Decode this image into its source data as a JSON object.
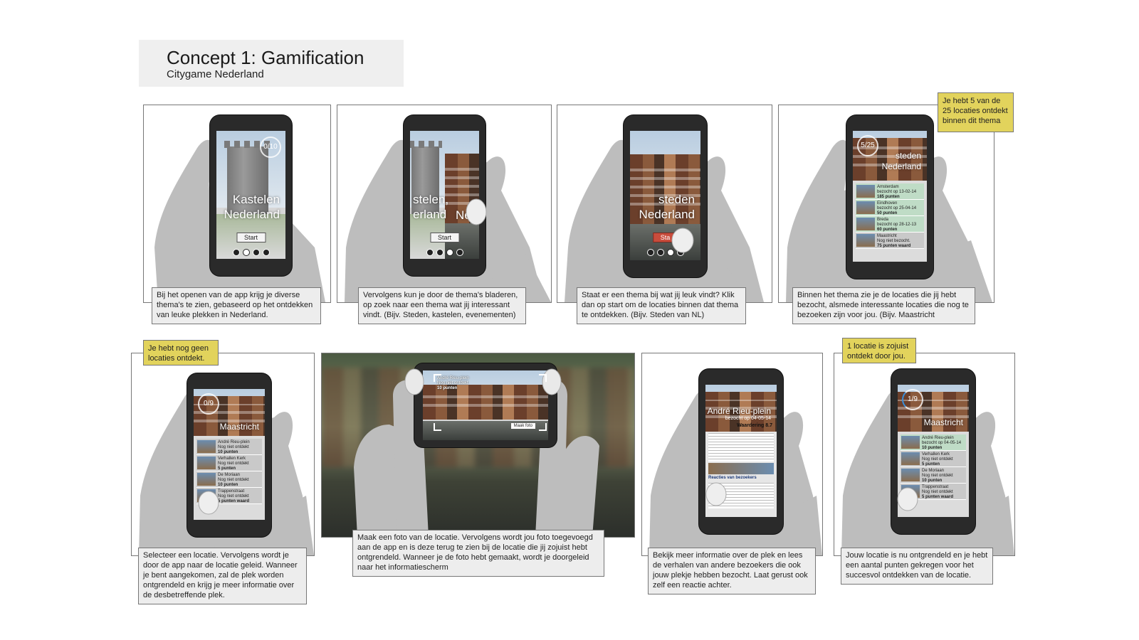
{
  "header": {
    "title": "Concept 1: Gamification",
    "subtitle": "Citygame Nederland"
  },
  "panels": [
    {
      "caption": "Bij het openen van de app krijg je diverse thema's te zien, gebaseerd op het ontdekken van leuke plekken in Nederland.",
      "screen_title": "Kastelen Nederland",
      "button": "Start",
      "counter": "0/10"
    },
    {
      "caption": "Vervolgens kun je door de thema's bladeren, op zoek naar een thema wat jij interessant vindt. (Bijv. Steden, kastelen, evenementen)",
      "screen_title": "stelen, erland",
      "screen_title_2": "Ne",
      "button": "Start"
    },
    {
      "caption": "Staat er een thema bij wat jij leuk vindt? Klik dan op start om de locaties binnen dat thema te ontdekken. (Bijv. Steden van NL)",
      "screen_title": "steden Nederland",
      "button": "Sta"
    },
    {
      "caption": "Binnen het thema zie je de locaties die jij hebt bezocht, alsmede interessante locaties die nog te bezoeken zijn voor jou. (Bijv. Maastricht",
      "note": "Je hebt 5 van de 25 locaties ontdekt binnen dit thema",
      "counter": "5/25",
      "screen_title": "steden Nederland",
      "list": [
        {
          "name": "Amsterdam",
          "sub": "bezocht op 13-02-14",
          "pts": "185 punten"
        },
        {
          "name": "Eindhoven",
          "sub": "bezocht op 25-04-14",
          "pts": "50 punten"
        },
        {
          "name": "Breda",
          "sub": "bezocht op 28-12-13",
          "pts": "60 punten"
        },
        {
          "name": "Maastricht",
          "sub": "Nog niet bezocht.",
          "pts": "75 punten waard"
        }
      ]
    },
    {
      "caption": "Selecteer een locatie. Vervolgens wordt je door de app naar de locatie geleid. Wanneer je bent aangekomen, zal de plek worden ontgrendeld en krijg je meer informatie over de desbetreffende plek.",
      "note": "Je hebt nog geen locaties ontdekt.",
      "counter": "0/9",
      "screen_title": "Maastricht",
      "list": [
        {
          "name": "André Rieu-plein",
          "sub": "Nog niet ontdekt",
          "pts": "10 punten"
        },
        {
          "name": "Verhallen Kerk",
          "sub": "Nog niet ontdekt",
          "pts": "5 punten"
        },
        {
          "name": "De Moriaan",
          "sub": "Nog niet ontdekt",
          "pts": "10 punten"
        },
        {
          "name": "Trappenstraat",
          "sub": "Nog niet ontdekt",
          "pts": "5 punten waard"
        }
      ]
    },
    {
      "caption": "Maak een foto van de locatie. Vervolgens wordt jou foto toegevoegd aan de app en is deze terug te zien bij de locatie die jij zojuist hebt ontgrendeld. Wanneer je de foto hebt gemaakt, wordt je doorgeleid naar het informatiescherm",
      "overlay_name": "André Rieu-plein",
      "overlay_sub": "Nog niet ontdekt",
      "overlay_pts": "10 punten",
      "button": "Maak foto"
    },
    {
      "caption": "Bekijk meer informatie over de plek en lees de verhalen van andere bezoekers die ook jouw plekje hebben bezocht. Laat gerust ook zelf een reactie achter.",
      "screen_title": "André Rieu-plein",
      "screen_sub": "bezocht op 04-05-14",
      "rating": "Waardering 8.7",
      "reactions": "Reacties van bezoekers"
    },
    {
      "caption": "Jouw locatie is nu ontgrendeld en je hebt een aantal punten gekregen voor het succesvol ontdekken van de locatie.",
      "note": "1 locatie is zojuist ontdekt door jou.",
      "counter": "1/9",
      "screen_title": "Maastricht",
      "list": [
        {
          "name": "André Rieu-plein",
          "sub": "bezocht op 04-05-14",
          "pts": "10 punten"
        },
        {
          "name": "Verhallen Kerk",
          "sub": "Nog niet ontdekt",
          "pts": "5 punten"
        },
        {
          "name": "De Moriaan",
          "sub": "Nog niet ontdekt",
          "pts": "10 punten"
        },
        {
          "name": "Trappenstraat",
          "sub": "Nog niet ontdekt",
          "pts": "5 punten waard"
        }
      ]
    }
  ]
}
